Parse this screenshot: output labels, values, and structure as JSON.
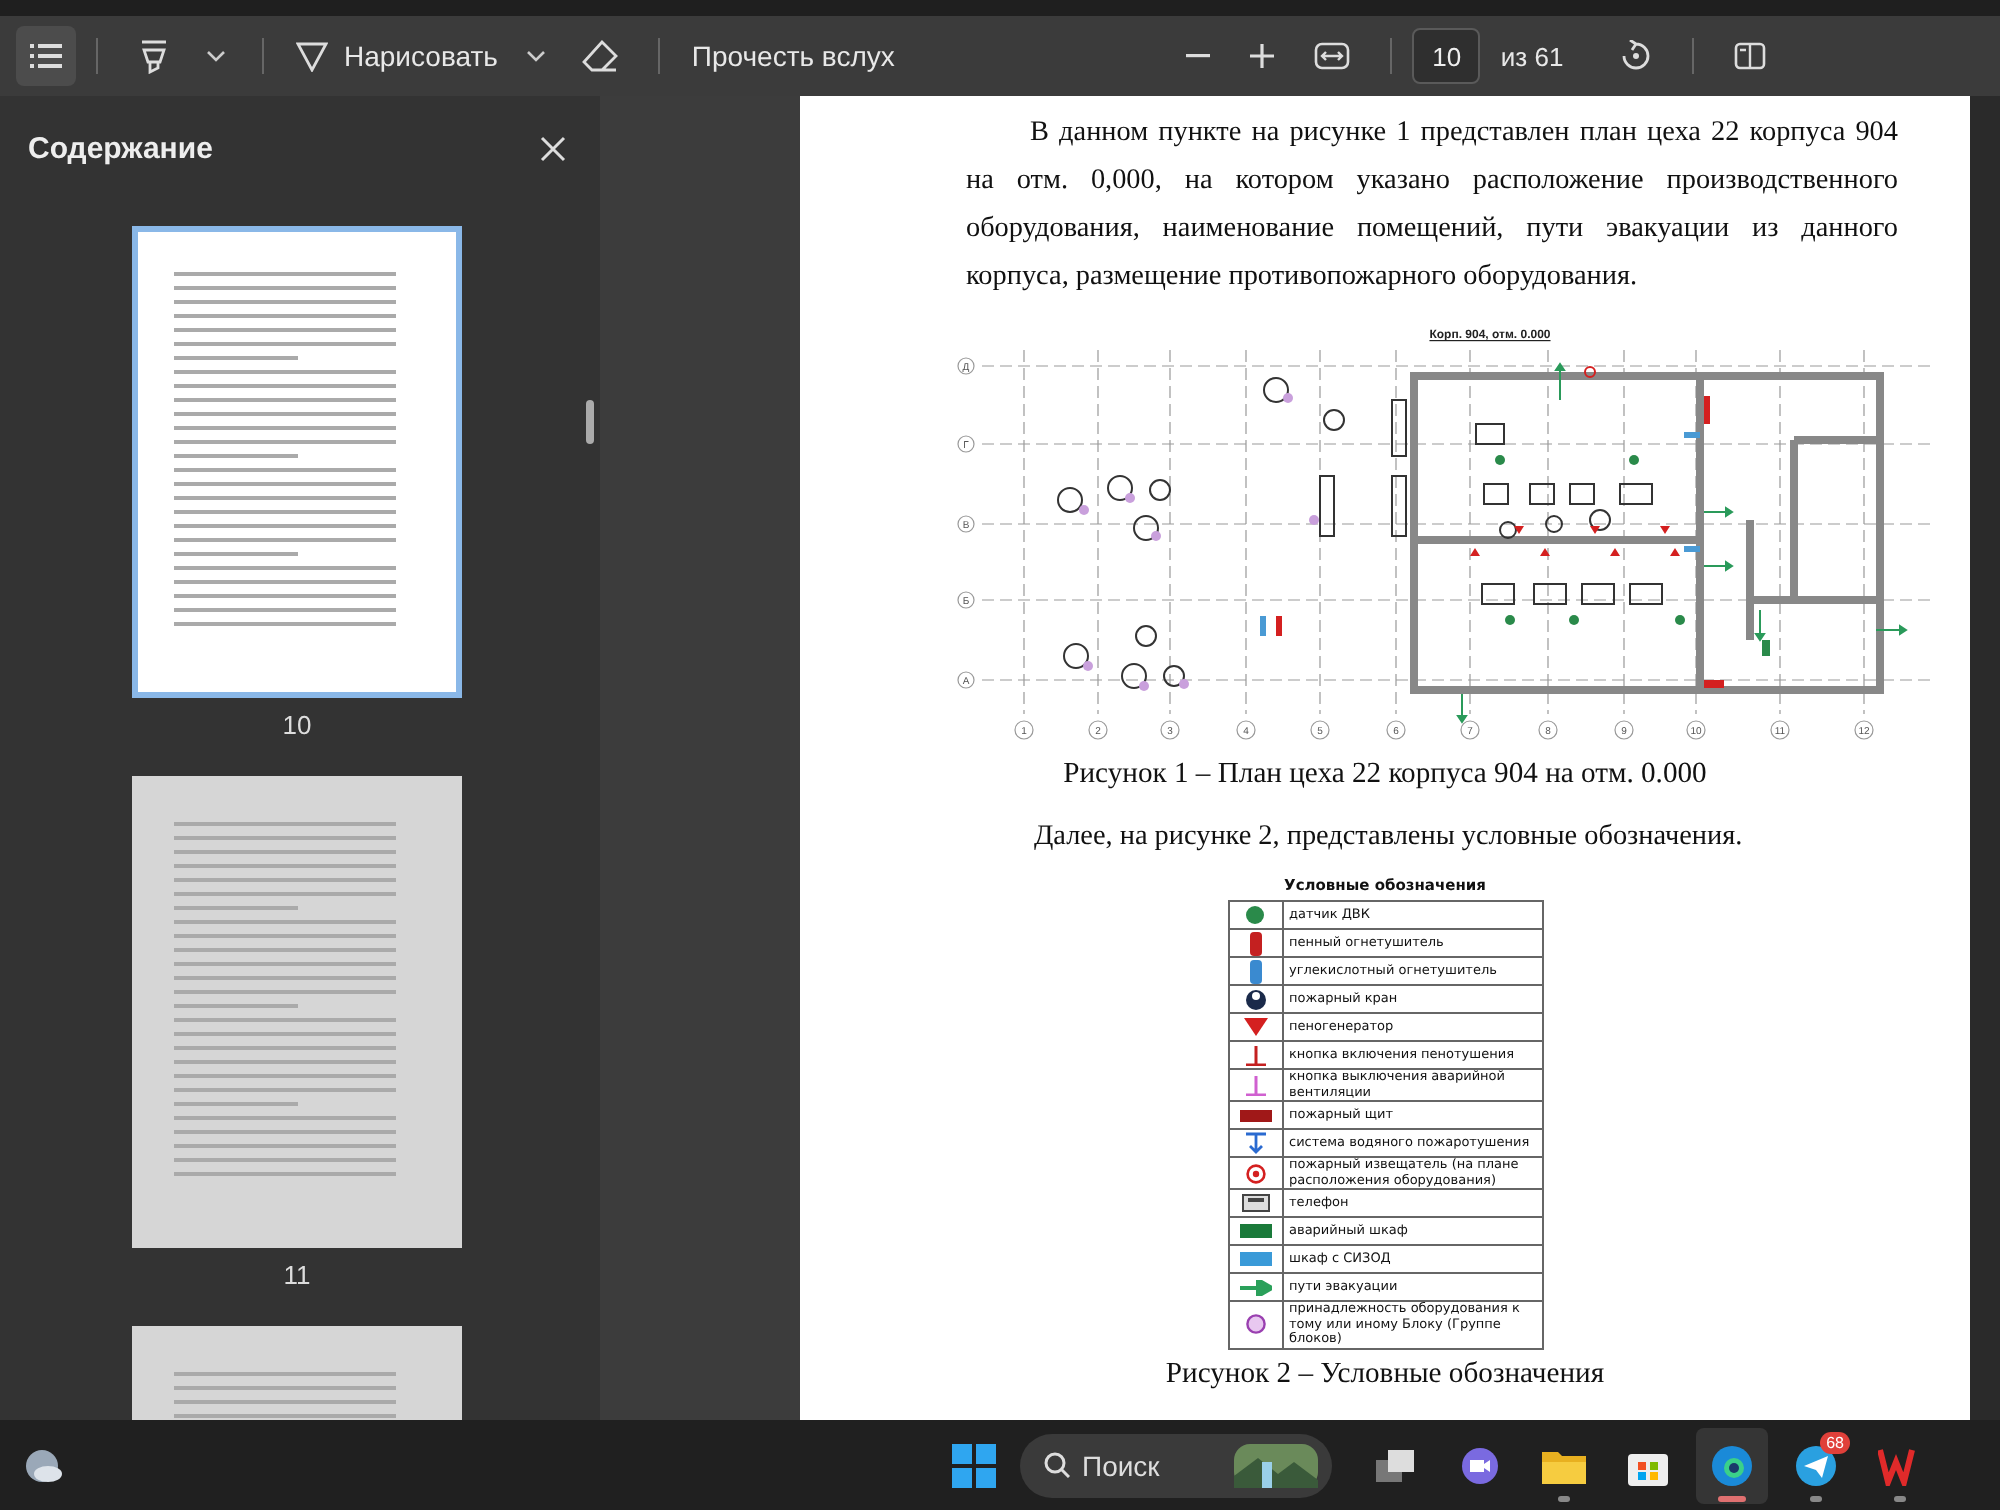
{
  "toolbar": {
    "contents_button": {
      "selected": true
    },
    "draw_button": "Нарисовать",
    "read_aloud_button": "Прочесть вслух",
    "page_field": {
      "value": "10"
    },
    "page_count": "из 61"
  },
  "sidebar": {
    "title": "Содержание",
    "thumbnails": [
      {
        "label": "10",
        "selected": true
      },
      {
        "label": "11",
        "selected": false
      },
      {
        "selected": false
      }
    ]
  },
  "document": {
    "paragraph_1": "В данном пункте на рисунке 1 представлен план цеха 22 корпуса 904 на отм. 0,000, на котором указано расположение производственного оборудования, наименование помещений, пути эвакуации из данного корпуса, размещение противопожарного оборудования.",
    "figure_1": {
      "title": "Корп. 904, отм. 0.000",
      "row_axes": [
        "Д",
        "Г",
        "В",
        "Б",
        "А"
      ],
      "column_axes": [
        "1",
        "2",
        "3",
        "4",
        "5",
        "6",
        "7",
        "8",
        "9",
        "10",
        "11",
        "12"
      ]
    },
    "caption_1": "Рисунок 1 – План цеха 22 корпуса 904 на отм. 0.000",
    "paragraph_2": "Далее, на рисунке 2, представлены условные обозначения.",
    "legend": {
      "title": "Условные обозначения",
      "rows": [
        {
          "kind": "sensor",
          "label": "датчик ДВК"
        },
        {
          "kind": "foam-extinguisher",
          "label": "пенный огнетушитель"
        },
        {
          "kind": "co2-extinguisher",
          "label": "углекислотный огнетушитель"
        },
        {
          "kind": "hydrant",
          "label": "пожарный кран"
        },
        {
          "kind": "foam-generator",
          "label": "пеногенератор"
        },
        {
          "kind": "foam-button",
          "label": "кнопка включения пенотушения"
        },
        {
          "kind": "vent-button",
          "label": "кнопка выключения аварийной вентиляции"
        },
        {
          "kind": "fire-panel",
          "label": "пожарный щит"
        },
        {
          "kind": "water-system",
          "label": "система водяного пожаротушения"
        },
        {
          "kind": "detector",
          "label": "пожарный извещатель (на плане расположения оборудования)"
        },
        {
          "kind": "phone",
          "label": "телефон"
        },
        {
          "kind": "cabinet",
          "label": "аварийный шкаф"
        },
        {
          "kind": "respirator-cabinet",
          "label": "шкаф с СИЗОД"
        },
        {
          "kind": "exit-arrow",
          "label": "пути эвакуации"
        },
        {
          "kind": "group-mark",
          "label": "принадлежность оборудования к тому или иному Блоку (Группе блоков)"
        }
      ]
    },
    "caption_2": "Рисунок 2 – Условные обозначения"
  },
  "taskbar": {
    "search": {
      "placeholder": "Поиск"
    },
    "apps": [
      {
        "kind": "task-view",
        "running": false,
        "active": false
      },
      {
        "kind": "meet",
        "running": false,
        "active": false
      },
      {
        "kind": "folder",
        "running": true,
        "active": false
      },
      {
        "kind": "store",
        "running": false,
        "active": false
      },
      {
        "kind": "browser",
        "running": true,
        "active": true
      },
      {
        "kind": "telegram",
        "running": true,
        "active": false,
        "badge": "68"
      },
      {
        "kind": "office",
        "running": true,
        "active": false
      }
    ]
  }
}
